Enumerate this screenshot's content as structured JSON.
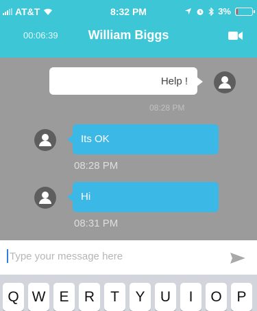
{
  "status_bar": {
    "carrier": "AT&T",
    "time": "8:32 PM",
    "battery": "3%",
    "battery_level": 0.03
  },
  "nav": {
    "call_timer": "00:06:39",
    "contact_name": "William Biggs",
    "video_icon": "video-camera-icon"
  },
  "messages": [
    {
      "direction": "outgoing",
      "text": "Help !",
      "time": "08:28 PM"
    },
    {
      "direction": "incoming",
      "text": "Its OK",
      "time": "08:28 PM"
    },
    {
      "direction": "incoming",
      "text": "Hi",
      "time": "08:31 PM"
    }
  ],
  "composer": {
    "placeholder": "Type your message here",
    "send_icon": "send-icon"
  },
  "keyboard": {
    "row1": [
      "Q",
      "W",
      "E",
      "R",
      "T",
      "Y",
      "U",
      "I",
      "O",
      "P"
    ]
  },
  "colors": {
    "header": "#3cc6d6",
    "chat_background": "#9b9b9b",
    "incoming_bubble": "#3cb8e6",
    "outgoing_bubble": "#ffffff"
  }
}
